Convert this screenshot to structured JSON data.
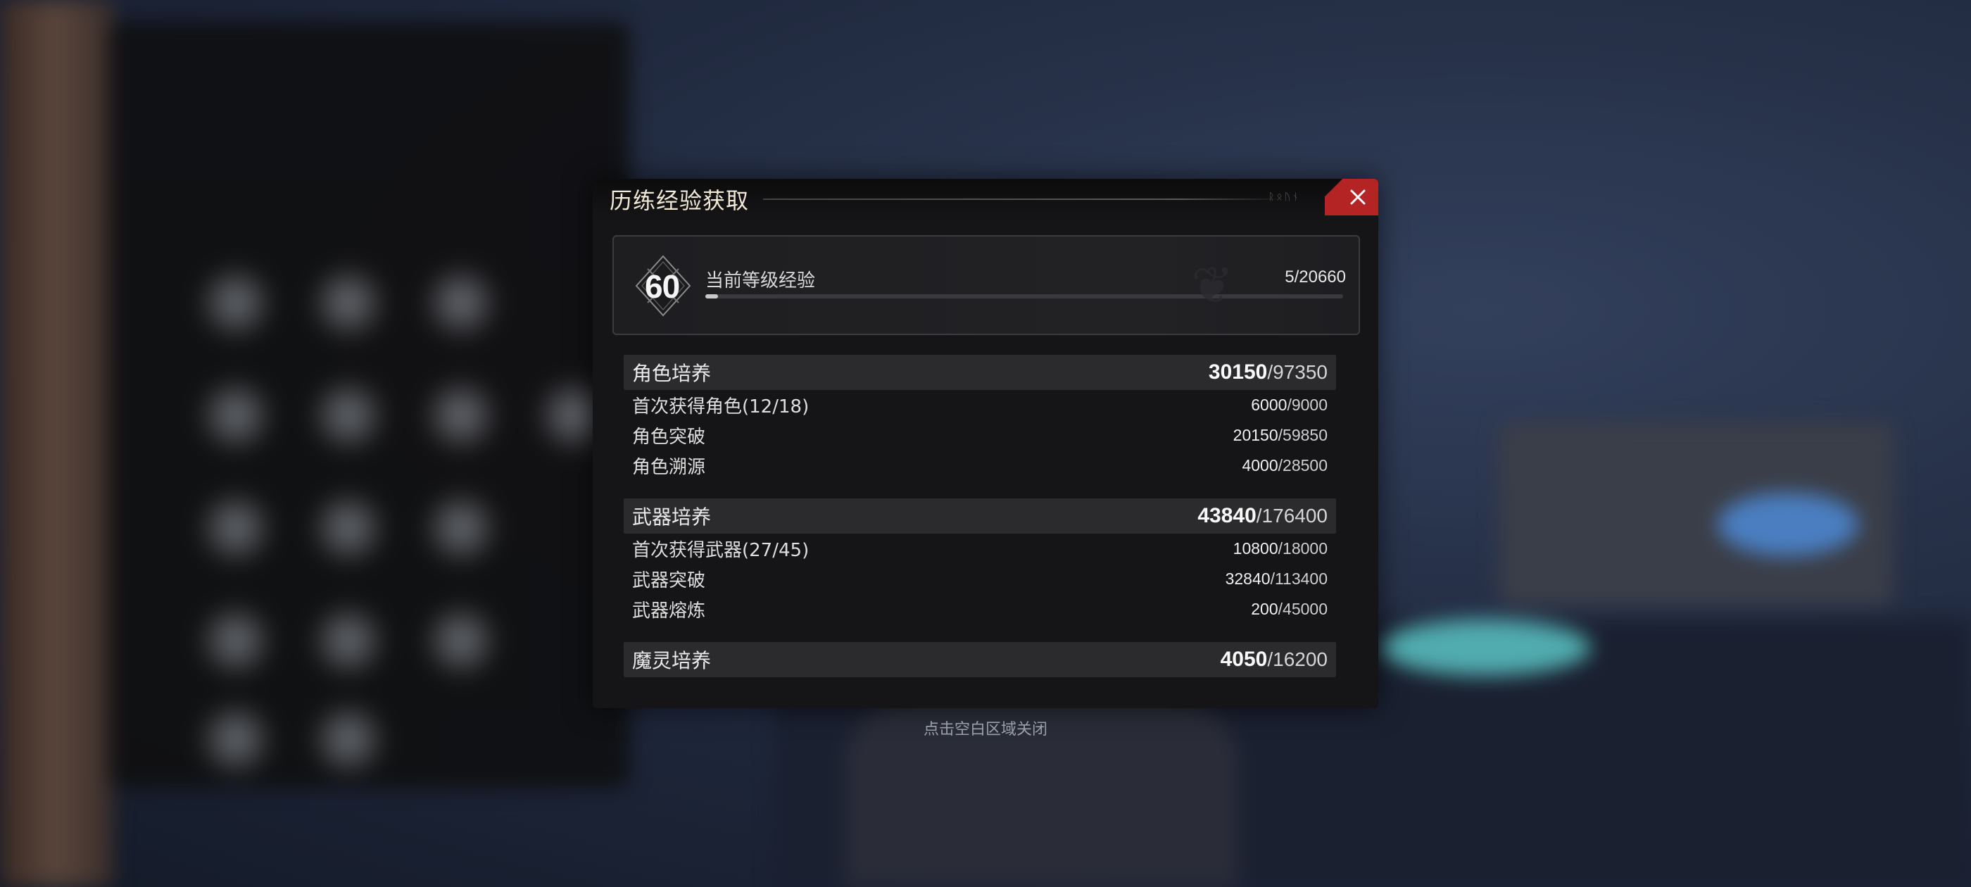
{
  "dialog": {
    "title": "历练经验获取",
    "header_deco": "ᚱᛟᚢᚾ",
    "level": {
      "number": "60",
      "label": "当前等级经验",
      "current": "5",
      "total": "/20660",
      "progress": 0.0002
    },
    "sections": [
      {
        "label": "角色培养",
        "current": "30150",
        "total": "/97350",
        "rows": [
          {
            "label": "首次获得角色(12/18)",
            "current": "6000",
            "total": "/9000"
          },
          {
            "label": "角色突破",
            "current": "20150",
            "total": "/59850"
          },
          {
            "label": "角色溯源",
            "current": "4000",
            "total": "/28500"
          }
        ]
      },
      {
        "label": "武器培养",
        "current": "43840",
        "total": "/176400",
        "rows": [
          {
            "label": "首次获得武器(27/45)",
            "current": "10800",
            "total": "/18000"
          },
          {
            "label": "武器突破",
            "current": "32840",
            "total": "/113400"
          },
          {
            "label": "武器熔炼",
            "current": "200",
            "total": "/45000"
          }
        ]
      },
      {
        "label": "魔灵培养",
        "current": "4050",
        "total": "/16200",
        "rows": []
      }
    ]
  },
  "hint": "点击空白区域关闭",
  "colors": {
    "close_button": "#b52424",
    "title_text": "#f2e8d6"
  }
}
